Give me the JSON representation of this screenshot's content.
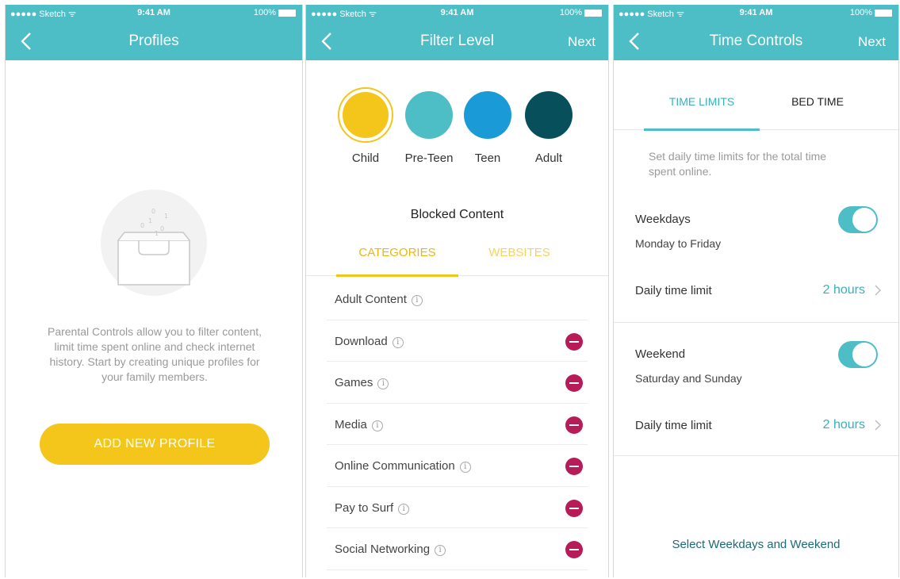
{
  "status": {
    "carrier": "●●●●● Sketch",
    "wifi": "ᯤ",
    "time": "9:41 AM",
    "battery": "100%"
  },
  "profiles": {
    "title": "Profiles",
    "description": "Parental Controls allow you to filter content, limit time spent online and check internet history. Start by creating unique profiles for your family members.",
    "add_button": "ADD NEW PROFILE"
  },
  "filter": {
    "title": "Filter Level",
    "next": "Next",
    "levels": [
      {
        "label": "Child",
        "color": "#f4c51a"
      },
      {
        "label": "Pre-Teen",
        "color": "#4dbdc6"
      },
      {
        "label": "Teen",
        "color": "#1a9ad6"
      },
      {
        "label": "Adult",
        "color": "#064f5b"
      }
    ],
    "blocked_title": "Blocked Content",
    "tabs": [
      "CATEGORIES",
      "WEBSITES"
    ],
    "categories": [
      {
        "name": "Adult Content",
        "blocked": false
      },
      {
        "name": "Download",
        "blocked": true
      },
      {
        "name": "Games",
        "blocked": true
      },
      {
        "name": "Media",
        "blocked": true
      },
      {
        "name": "Online Communication",
        "blocked": true
      },
      {
        "name": "Pay to Surf",
        "blocked": true
      },
      {
        "name": "Social Networking",
        "blocked": true
      }
    ]
  },
  "time": {
    "title": "Time Controls",
    "next": "Next",
    "tabs": [
      "TIME LIMITS",
      "BED TIME"
    ],
    "description": "Set daily time limits for the total time spent online.",
    "weekdays": {
      "label": "Weekdays",
      "sub": "Monday to Friday",
      "limit_label": "Daily time limit",
      "limit_value": "2 hours",
      "enabled": true
    },
    "weekend": {
      "label": "Weekend",
      "sub": "Saturday and Sunday",
      "limit_label": "Daily time limit",
      "limit_value": "2 hours",
      "enabled": true
    },
    "bottom_link": "Select Weekdays and Weekend"
  }
}
